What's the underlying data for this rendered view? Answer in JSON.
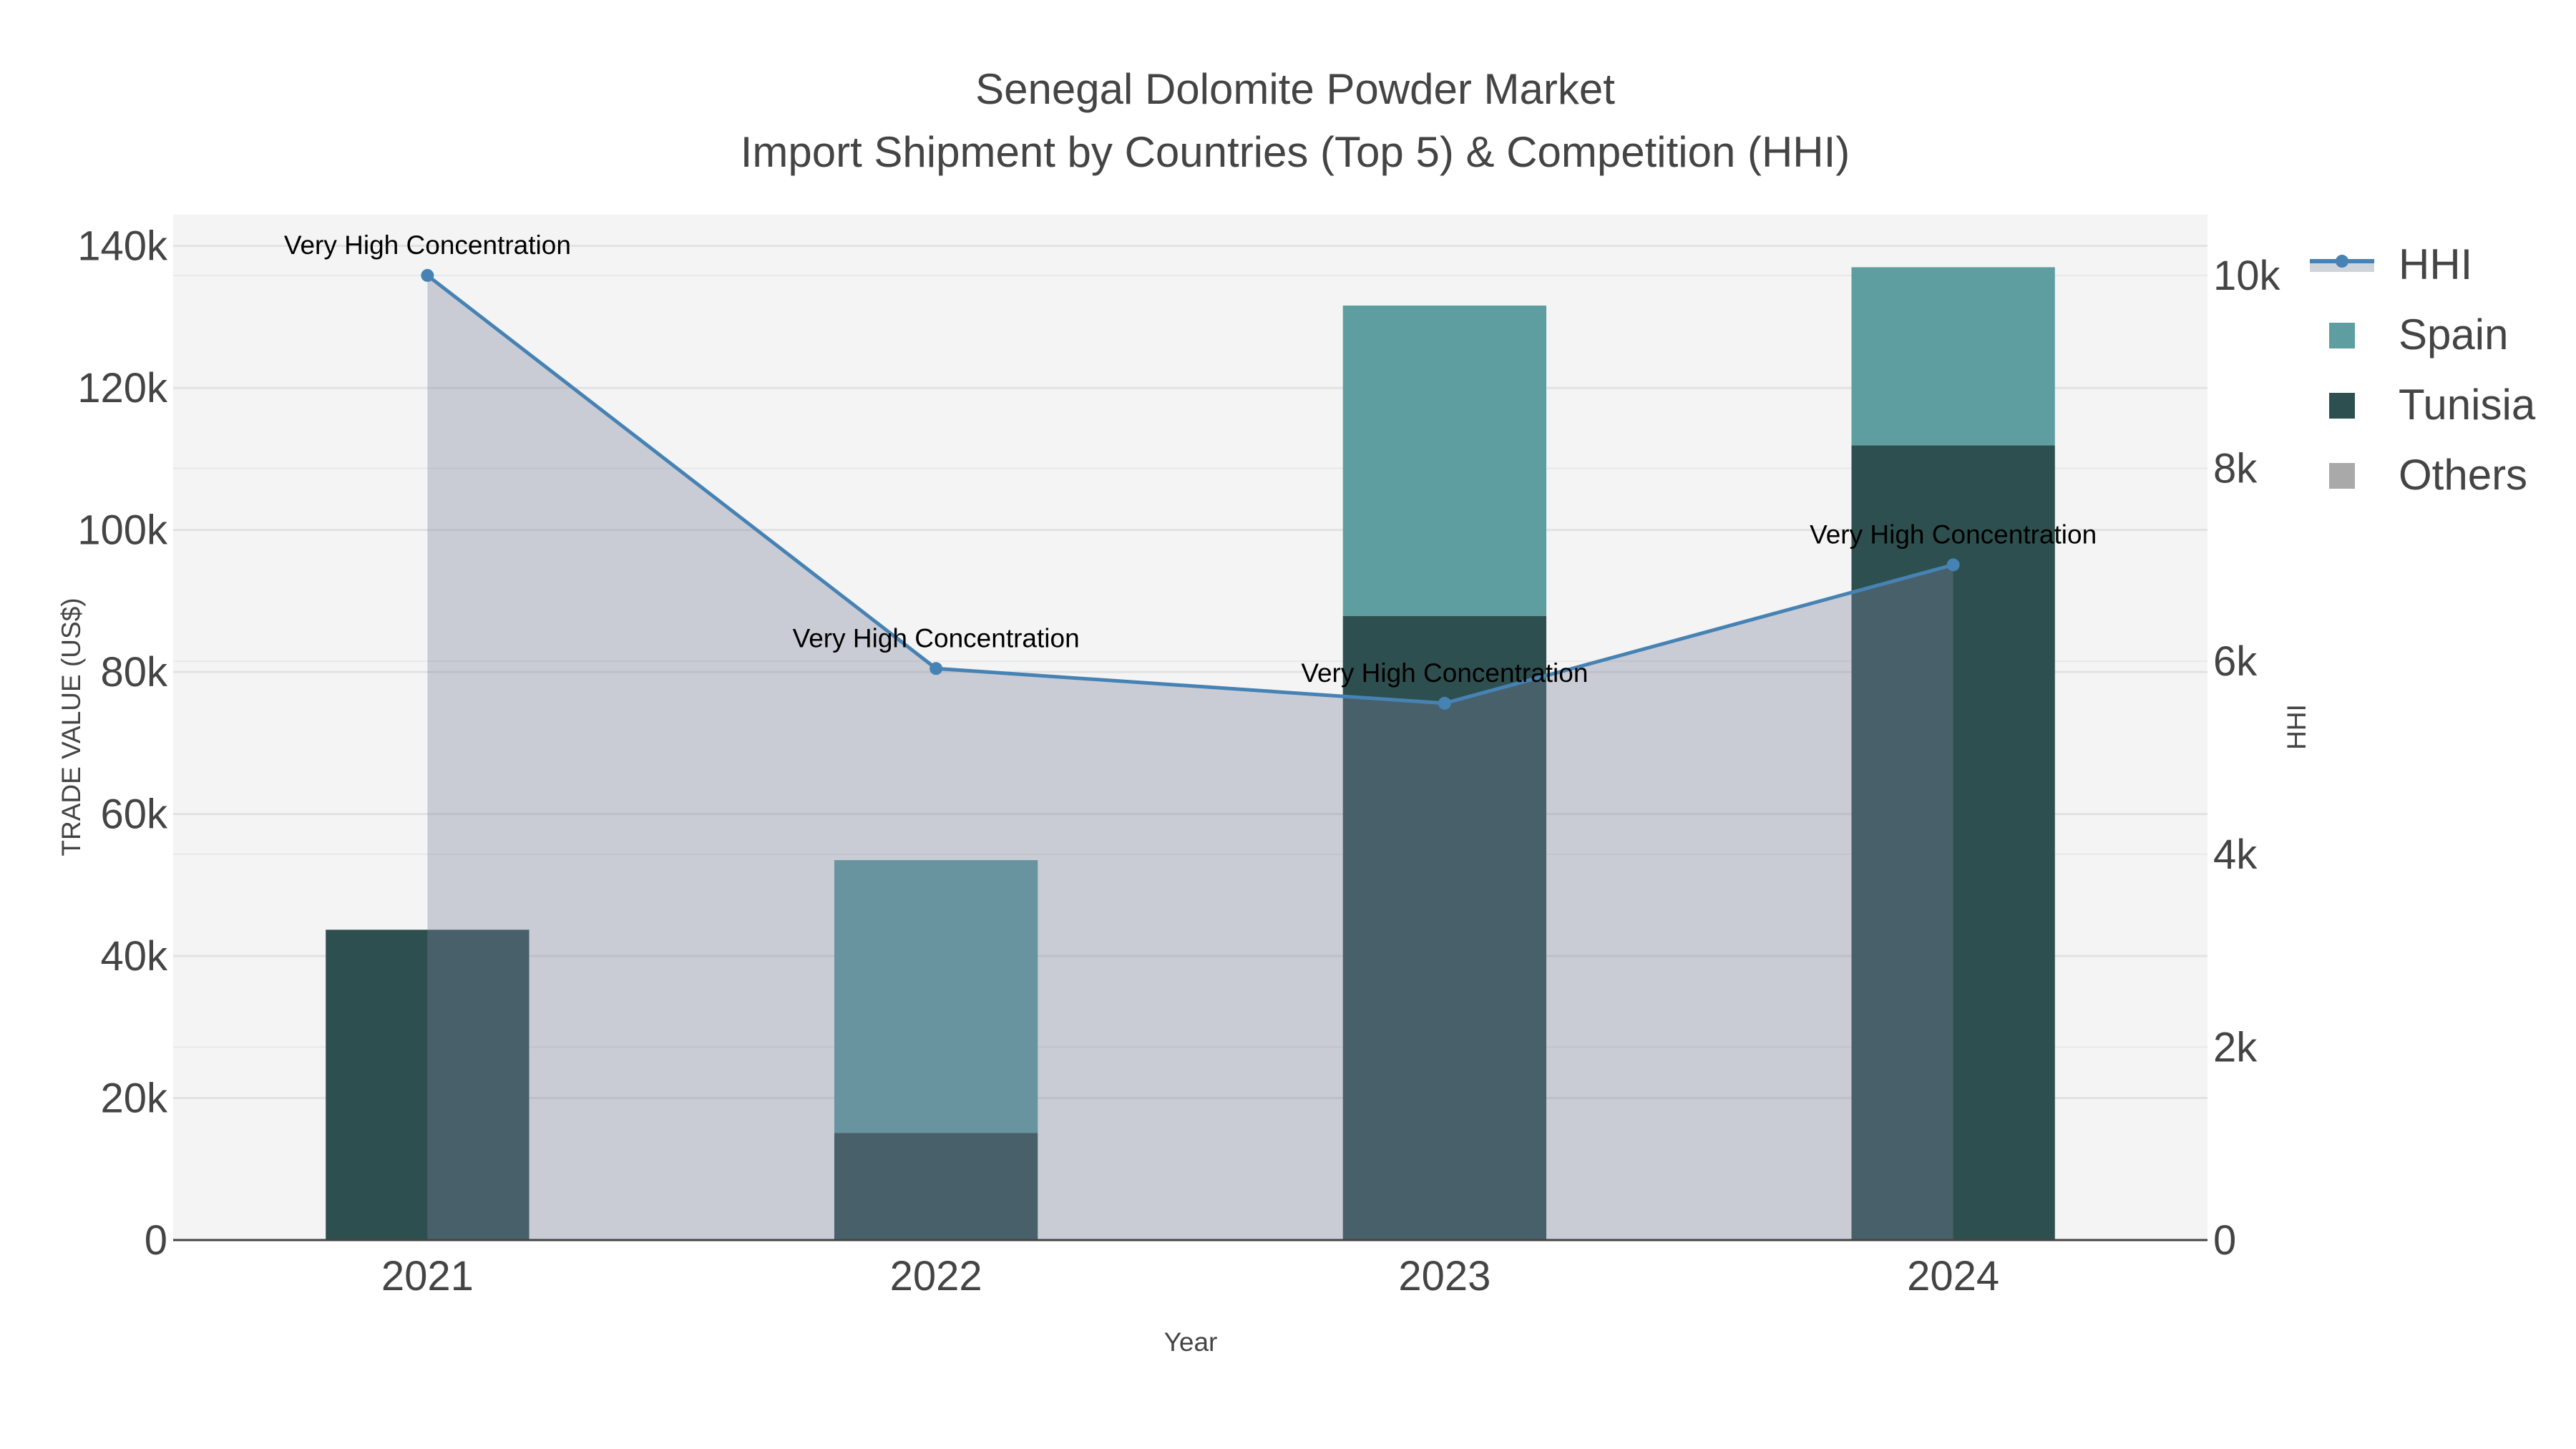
{
  "chart_data": {
    "type": "bar",
    "title": "Senegal Dolomite Powder Market",
    "subtitle": "Import Shipment by Countries (Top 5) & Competition (HHI)",
    "xlabel": "Year",
    "ylabel": "TRADE VALUE (US$)",
    "y2label": "HHI",
    "categories": [
      "2021",
      "2022",
      "2023",
      "2024"
    ],
    "ylim": [
      0,
      144400
    ],
    "y2lim": [
      0,
      10630
    ],
    "yticks": [
      0,
      20000,
      40000,
      60000,
      80000,
      100000,
      120000,
      140000
    ],
    "ytick_labels": [
      "0",
      "20k",
      "40k",
      "60k",
      "80k",
      "100k",
      "120k",
      "140k"
    ],
    "y2ticks": [
      0,
      2000,
      4000,
      6000,
      8000,
      10000
    ],
    "y2tick_labels": [
      "0",
      "2k",
      "4k",
      "6k",
      "8k",
      "10k"
    ],
    "barmode": "stack",
    "series": [
      {
        "name": "Tunisia",
        "type": "bar",
        "color": "#2e4f4f",
        "values": [
          43700,
          15100,
          87900,
          111900
        ]
      },
      {
        "name": "Spain",
        "type": "bar",
        "color": "#5f9ea0",
        "values": [
          0,
          38400,
          43700,
          25100
        ]
      },
      {
        "name": "Others",
        "type": "bar",
        "color": "#a9a9a9",
        "values": [
          0,
          0,
          0,
          0
        ]
      },
      {
        "name": "HHI",
        "type": "line-area",
        "axis": "y2",
        "color": "#4682b4",
        "fill": "rgba(120,130,155,0.35)",
        "values": [
          10000,
          5925,
          5565,
          7000
        ]
      }
    ],
    "annotations": [
      "Very High Concentration",
      "Very High Concentration",
      "Very High Concentration",
      "Very High Concentration"
    ],
    "legend": [
      "HHI",
      "Spain",
      "Tunisia",
      "Others"
    ],
    "legend_position": "right",
    "grid": true
  }
}
